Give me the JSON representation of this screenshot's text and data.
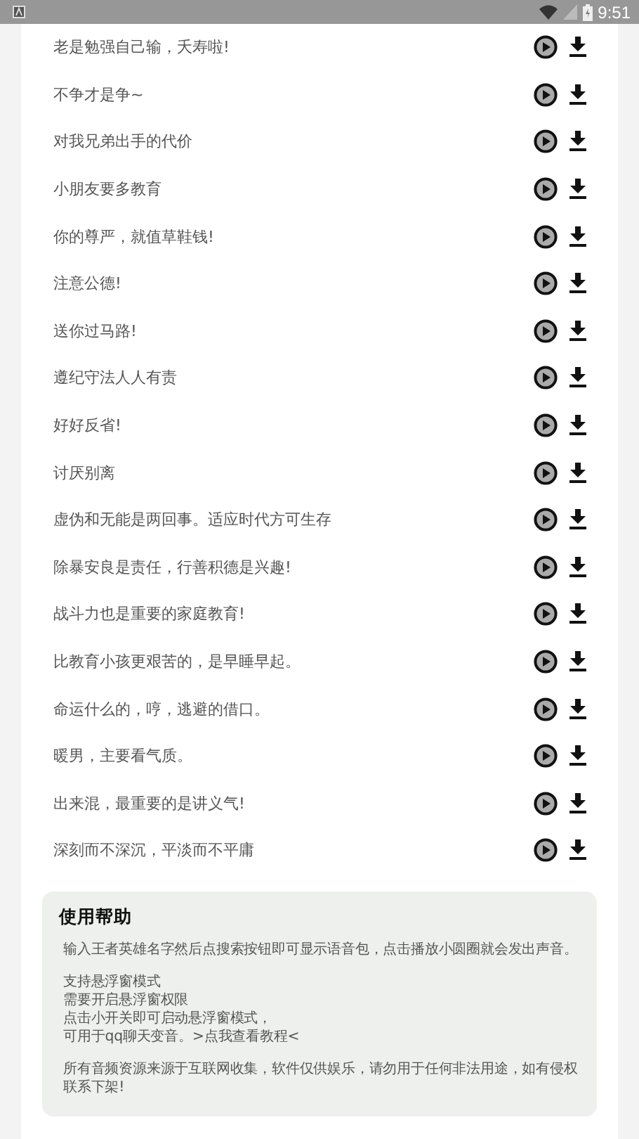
{
  "status_bar": {
    "time": "9:51"
  },
  "voice_lines": [
    {
      "text": "老是勉强自己输，夭寿啦!"
    },
    {
      "text": "不争才是争~"
    },
    {
      "text": "对我兄弟出手的代价"
    },
    {
      "text": "小朋友要多教育"
    },
    {
      "text": "你的尊严，就值草鞋钱!"
    },
    {
      "text": "注意公德!"
    },
    {
      "text": "送你过马路!"
    },
    {
      "text": "遵纪守法人人有责"
    },
    {
      "text": "好好反省!"
    },
    {
      "text": "讨厌别离"
    },
    {
      "text": "虚伪和无能是两回事。适应时代方可生存"
    },
    {
      "text": "除暴安良是责任，行善积德是兴趣!"
    },
    {
      "text": "战斗力也是重要的家庭教育!"
    },
    {
      "text": "比教育小孩更艰苦的，是早睡早起。"
    },
    {
      "text": "命运什么的，哼，逃避的借口。"
    },
    {
      "text": "暖男，主要看气质。"
    },
    {
      "text": "出来混，最重要的是讲义气!"
    },
    {
      "text": "深刻而不深沉，平淡而不平庸"
    }
  ],
  "help": {
    "title": "使用帮助",
    "paragraphs": [
      {
        "lines": [
          "输入王者英雄名字然后点搜索按钮即可显示语音包，点击播放小圆圈就会发出声音。"
        ]
      },
      {
        "lines": [
          "支持悬浮窗模式",
          "需要开启悬浮窗权限",
          "点击小开关即可启动悬浮窗模式，",
          "可用于qq聊天变音。>点我查看教程<"
        ]
      },
      {
        "lines": [
          "所有音频资源来源于互联网收集，软件仅供娱乐，请勿用于任何非法用途，如有侵权联系下架!"
        ]
      }
    ]
  }
}
